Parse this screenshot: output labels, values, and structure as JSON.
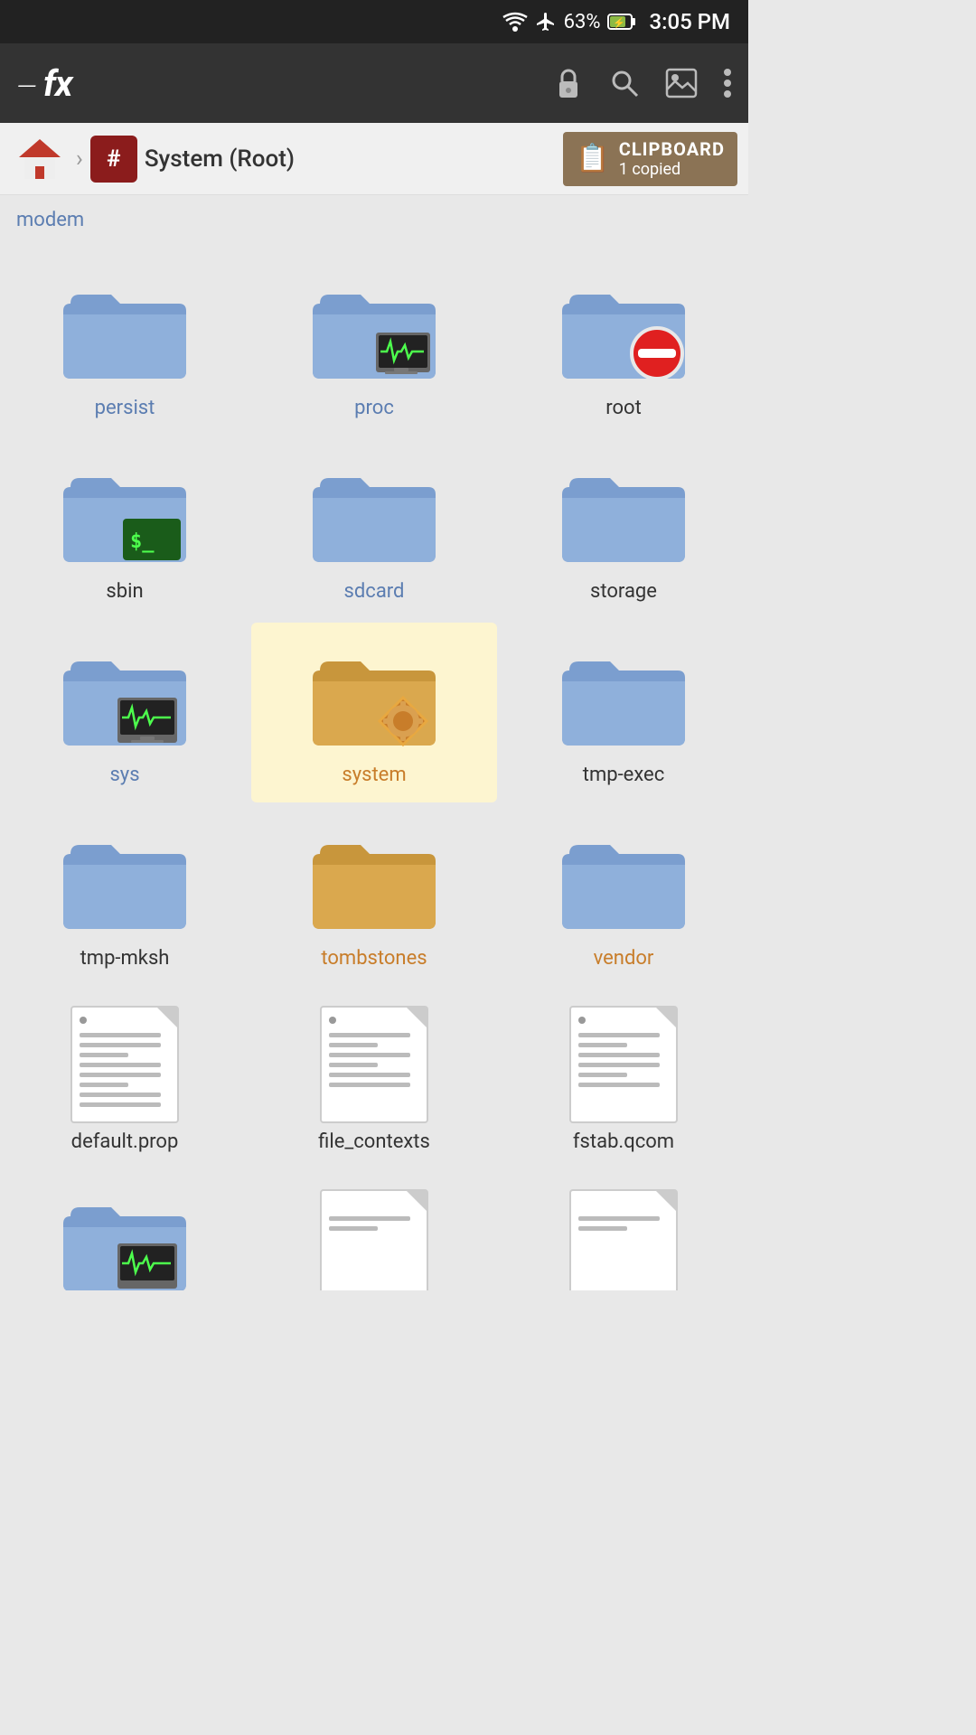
{
  "statusBar": {
    "time": "3:05 PM",
    "battery": "63%",
    "icons": [
      "wifi",
      "airplane",
      "battery"
    ]
  },
  "appBar": {
    "logo": "fx",
    "actions": [
      "lock",
      "search",
      "image",
      "more"
    ]
  },
  "breadcrumb": {
    "homeLabel": "home",
    "hashLabel": "#",
    "title": "System (Root)",
    "clipboard": {
      "label": "CLIPBOARD",
      "count": "1 copied"
    }
  },
  "partialTop": {
    "label": "modem"
  },
  "folders": [
    {
      "id": "persist",
      "label": "persist",
      "type": "folder",
      "style": "blue",
      "badge": null
    },
    {
      "id": "proc",
      "label": "proc",
      "type": "folder",
      "style": "blue",
      "badge": "monitor"
    },
    {
      "id": "root",
      "label": "root",
      "type": "folder",
      "style": "normal",
      "badge": "noentry"
    },
    {
      "id": "sbin",
      "label": "sbin",
      "type": "folder",
      "style": "normal",
      "badge": "terminal"
    },
    {
      "id": "sdcard",
      "label": "sdcard",
      "type": "folder",
      "style": "blue",
      "badge": null
    },
    {
      "id": "storage",
      "label": "storage",
      "type": "folder",
      "style": "normal",
      "badge": null
    },
    {
      "id": "sys",
      "label": "sys",
      "type": "folder",
      "style": "blue",
      "badge": "monitor"
    },
    {
      "id": "system",
      "label": "system",
      "type": "folder",
      "style": "orange",
      "badge": "gear",
      "selected": true
    },
    {
      "id": "tmp-exec",
      "label": "tmp-exec",
      "type": "folder",
      "style": "normal",
      "badge": null
    },
    {
      "id": "tmp-mksh",
      "label": "tmp-mksh",
      "type": "folder",
      "style": "normal",
      "badge": null
    },
    {
      "id": "tombstones",
      "label": "tombstones",
      "type": "folder",
      "style": "orange",
      "badge": null
    },
    {
      "id": "vendor",
      "label": "vendor",
      "type": "folder",
      "style": "orange",
      "badge": null
    }
  ],
  "files": [
    {
      "id": "default.prop",
      "label": "default.prop",
      "type": "file"
    },
    {
      "id": "file_contexts",
      "label": "file_contexts",
      "type": "file"
    },
    {
      "id": "fstab.qcom",
      "label": "fstab.qcom",
      "type": "file"
    }
  ],
  "bottomPartial": [
    {
      "id": "folder-partial-1",
      "type": "folder-partial"
    },
    {
      "id": "file-partial-2",
      "type": "file-partial"
    },
    {
      "id": "file-partial-3",
      "type": "file-partial"
    }
  ]
}
